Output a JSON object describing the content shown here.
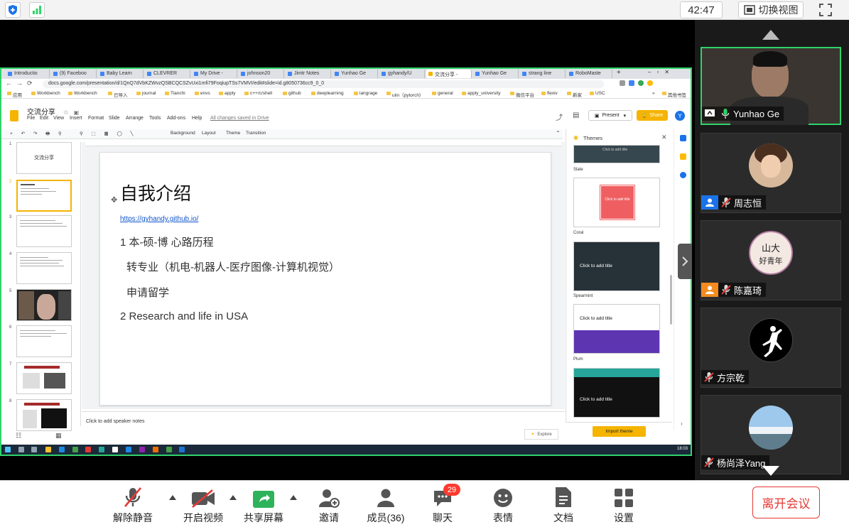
{
  "topbar": {
    "clock": "42:47",
    "switch_view_label": "切换视图",
    "shield_color": "#1a73e8",
    "signal_color": "#2fd36a"
  },
  "browser": {
    "tabs": [
      "Introductio",
      "(9) Faceboo",
      "Baby Learn",
      "CLEVRER",
      "My Drive -",
      "johnson20",
      "Jimtr Notes",
      "Yunhao Ge",
      "gyhandy/U",
      "交流分享 -",
      "Yunhao Ge",
      "strang line",
      "RoboMaste"
    ],
    "url": "docs.google.com/presentation/d/1QnQ7dVbKZWvzQSBCQCSZvUxi1mfi79FoqiupTSs7VMVI/edit#slide=id.g8050736cc9_0_0",
    "bookmarks": [
      "应用",
      "Workbench",
      "Workbench",
      "已导入",
      "journal",
      "Tianchi",
      "envs",
      "apply",
      "c++/c/shell",
      "github",
      "deeplearning",
      "langrage",
      "uiin（pytorch）",
      "general",
      "apply_university",
      "微信平台",
      "flexiv",
      "新家",
      "USC",
      "»",
      "其他书签"
    ]
  },
  "slides_app": {
    "doc_title": "交流分享",
    "menus": [
      "File",
      "Edit",
      "View",
      "Insert",
      "Format",
      "Slide",
      "Arrange",
      "Tools",
      "Add-ons",
      "Help"
    ],
    "saved_status": "All changes saved in Drive",
    "present_label": "Present",
    "share_label": "Share",
    "avatar_letter": "Y",
    "toolbar": [
      "Background",
      "Layout",
      "Theme",
      "Transition"
    ],
    "thumb_numbers": [
      "1",
      "2",
      "3",
      "4",
      "5",
      "6",
      "7",
      "8"
    ],
    "thumb1_title": "交流分享",
    "notes_placeholder": "Click to add speaker notes",
    "explore_label": "Explore"
  },
  "slide": {
    "title": "自我介绍",
    "link": "https://gyhandy.github.io/",
    "lines": [
      "1 本-硕-博 心路历程",
      "转专业（机电-机器人-医疗图像-计算机视觉）",
      "申请留学",
      "2 Research and life in USA"
    ]
  },
  "themes_panel": {
    "title": "Themes",
    "themes": [
      {
        "name": "Slate",
        "card_title": "Click to add title"
      },
      {
        "name": "Coral",
        "card_title": "Click to add title"
      },
      {
        "name": "Spearmint",
        "card_title": "Click to add title"
      },
      {
        "name": "Plum",
        "card_title": "Click to add title"
      },
      {
        "name": "",
        "card_title": "Click to add title"
      }
    ],
    "import_label": "Import theme"
  },
  "taskbar": {
    "clock": "18:03"
  },
  "participants": [
    {
      "name": "Yunhao Ge",
      "active": true
    },
    {
      "name": "周志恒"
    },
    {
      "name": "陈嘉琦"
    },
    {
      "name": "方宗乾"
    },
    {
      "name": "杨尚泽Yang"
    }
  ],
  "avatar_text": {
    "line1": "山大",
    "line2": "好青年"
  },
  "bottombar": {
    "unmute": "解除静音",
    "start_video": "开启视频",
    "share_screen": "共享屏幕",
    "invite": "邀请",
    "members": "成员(36)",
    "chat": "聊天",
    "chat_badge": "29",
    "reactions": "表情",
    "docs": "文档",
    "settings": "设置",
    "leave": "离开会议"
  }
}
